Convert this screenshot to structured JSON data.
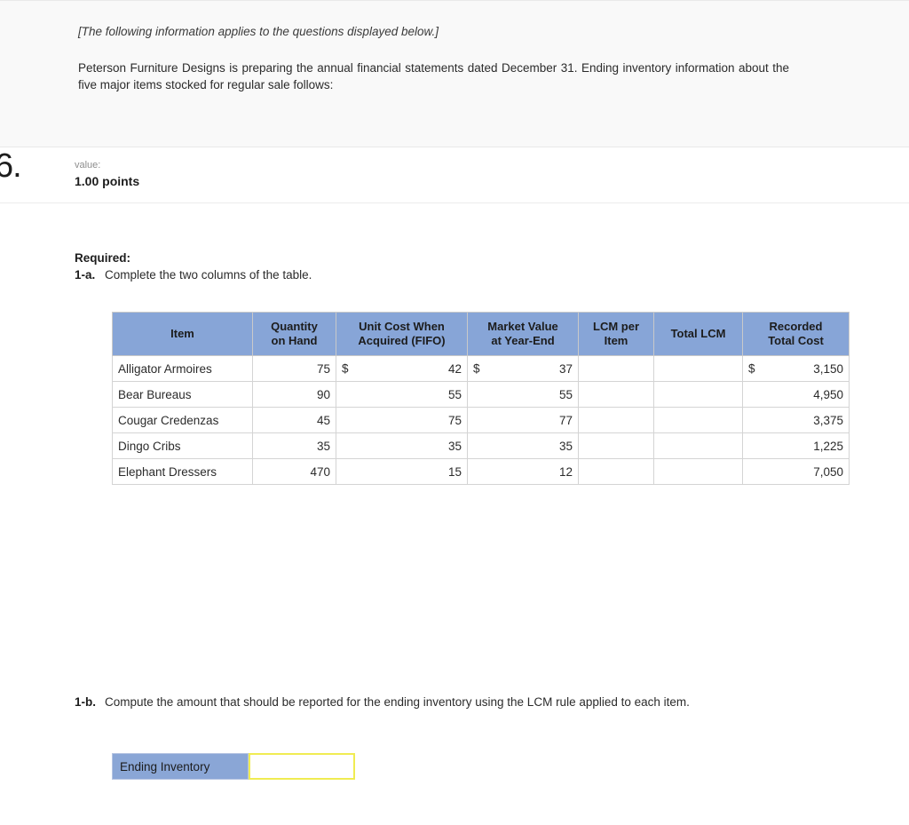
{
  "banner": {
    "applies_note": "[The following information applies to the questions displayed below.]",
    "paragraph": "Peterson Furniture Designs is preparing the annual financial statements dated December 31. Ending inventory information about the five major items stocked for regular sale follows:"
  },
  "question": {
    "number": "6.",
    "value_label": "value:",
    "points": "1.00 points"
  },
  "required": {
    "title": "Required:",
    "part_a_tag": "1-a.",
    "part_a_text": "Complete the two columns of the table."
  },
  "table": {
    "headers": [
      "Item",
      "Quantity on Hand",
      "Unit Cost When Acquired (FIFO)",
      "Market Value at Year-End",
      "LCM per Item",
      "Total LCM",
      "Recorded Total Cost"
    ],
    "header_lines": [
      [
        "Item"
      ],
      [
        "Quantity",
        "on Hand"
      ],
      [
        "Unit Cost When",
        "Acquired (FIFO)"
      ],
      [
        "Market Value",
        "at Year-End"
      ],
      [
        "LCM per",
        "Item"
      ],
      [
        "Total LCM"
      ],
      [
        "Recorded",
        "Total Cost"
      ]
    ],
    "currency_symbol": "$",
    "rows": [
      {
        "item": "Alligator Armoires",
        "quantity_on_hand": "75",
        "unit_cost_fifo": "42",
        "unit_cost_currency": "$",
        "market_value": "37",
        "market_value_currency": "$",
        "lcm_per_item": "",
        "total_lcm": "",
        "recorded_total_cost": "3,150",
        "recorded_currency": "$"
      },
      {
        "item": "Bear Bureaus",
        "quantity_on_hand": "90",
        "unit_cost_fifo": "55",
        "unit_cost_currency": "",
        "market_value": "55",
        "market_value_currency": "",
        "lcm_per_item": "",
        "total_lcm": "",
        "recorded_total_cost": "4,950",
        "recorded_currency": ""
      },
      {
        "item": "Cougar Credenzas",
        "quantity_on_hand": "45",
        "unit_cost_fifo": "75",
        "unit_cost_currency": "",
        "market_value": "77",
        "market_value_currency": "",
        "lcm_per_item": "",
        "total_lcm": "",
        "recorded_total_cost": "3,375",
        "recorded_currency": ""
      },
      {
        "item": "Dingo Cribs",
        "quantity_on_hand": "35",
        "unit_cost_fifo": "35",
        "unit_cost_currency": "",
        "market_value": "35",
        "market_value_currency": "",
        "lcm_per_item": "",
        "total_lcm": "",
        "recorded_total_cost": "1,225",
        "recorded_currency": ""
      },
      {
        "item": "Elephant Dressers",
        "quantity_on_hand": "470",
        "unit_cost_fifo": "15",
        "unit_cost_currency": "",
        "market_value": "12",
        "market_value_currency": "",
        "lcm_per_item": "",
        "total_lcm": "",
        "recorded_total_cost": "7,050",
        "recorded_currency": ""
      }
    ]
  },
  "part_b": {
    "tag": "1-b.",
    "text": "Compute the amount that should be reported for the ending inventory using the LCM rule applied to each item.",
    "ending_inventory_label": "Ending Inventory",
    "ending_inventory_value": ""
  },
  "colors": {
    "header_blue": "#87a5d7",
    "input_yellow": "#f0ec52",
    "banner_gray": "#f9f9f9",
    "text_dark": "#2b2b2b"
  }
}
